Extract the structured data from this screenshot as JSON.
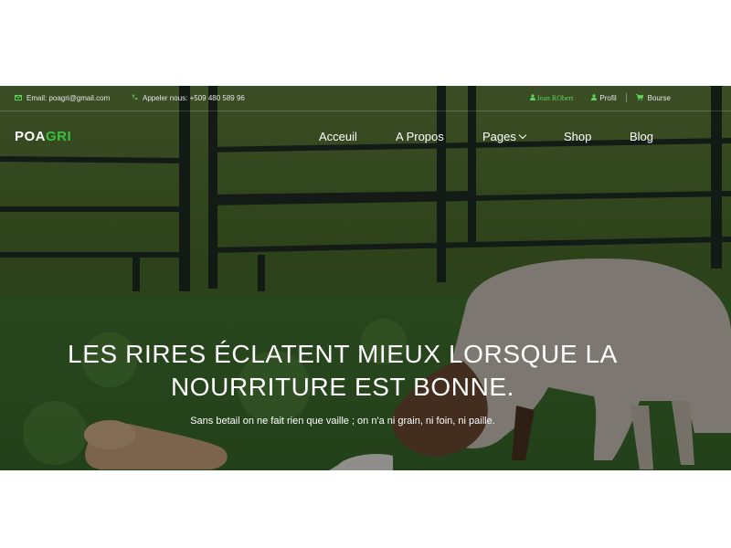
{
  "topbar": {
    "email": "Email: poagri@gmail.com",
    "phone": "Appeler nous: +509 480 589 96",
    "user": "Jean RObert",
    "profile": "Profil",
    "bourse": "Bourse",
    "icons": {
      "email": "envelope-icon",
      "phone": "phone-icon",
      "user": "user-icon",
      "profile": "user-icon",
      "bourse": "cart-icon"
    }
  },
  "logo": {
    "part1": "POA",
    "part2": "GRI"
  },
  "nav": {
    "items": [
      "Acceuil",
      "A Propos",
      "Pages",
      "Shop",
      "Blog"
    ]
  },
  "hero": {
    "headline_line1": "LES RIRES ÉCLATENT MIEUX LORSQUE LA",
    "headline_line2": "NOURRITURE EST BONNE.",
    "subtitle": "Sans betail on ne fait rien que vaille ; on n'a ni grain, ni foin, ni paille."
  },
  "colors": {
    "accent": "#39c03c",
    "icon_green": "#5fd35f",
    "text": "#ffffff"
  }
}
